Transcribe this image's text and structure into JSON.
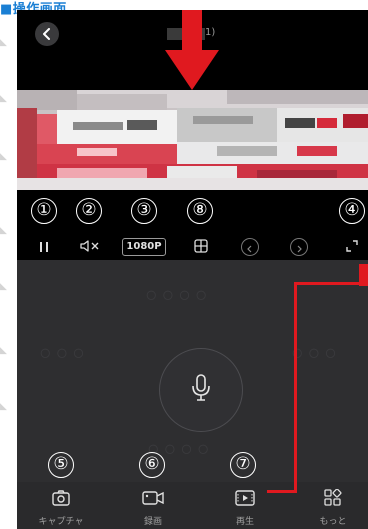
{
  "caption": "■操作画面",
  "header": {
    "title_suffix": "1)"
  },
  "controls": {
    "resolution_label": "1080P"
  },
  "callout_numbers": [
    "①",
    "②",
    "③",
    "④",
    "⑤",
    "⑥",
    "⑦",
    "⑧"
  ],
  "tabs": [
    {
      "label": "キャプチャ",
      "icon": "camera-icon"
    },
    {
      "label": "録画",
      "icon": "video-record-icon"
    },
    {
      "label": "再生",
      "icon": "playback-icon"
    },
    {
      "label": "もっと",
      "icon": "more-grid-icon"
    }
  ],
  "colors": {
    "caption": "#1a7fd4",
    "callout": "#e0191f",
    "panel_bg": "#2e2e30",
    "tabbar_bg": "#2a2a2c"
  }
}
